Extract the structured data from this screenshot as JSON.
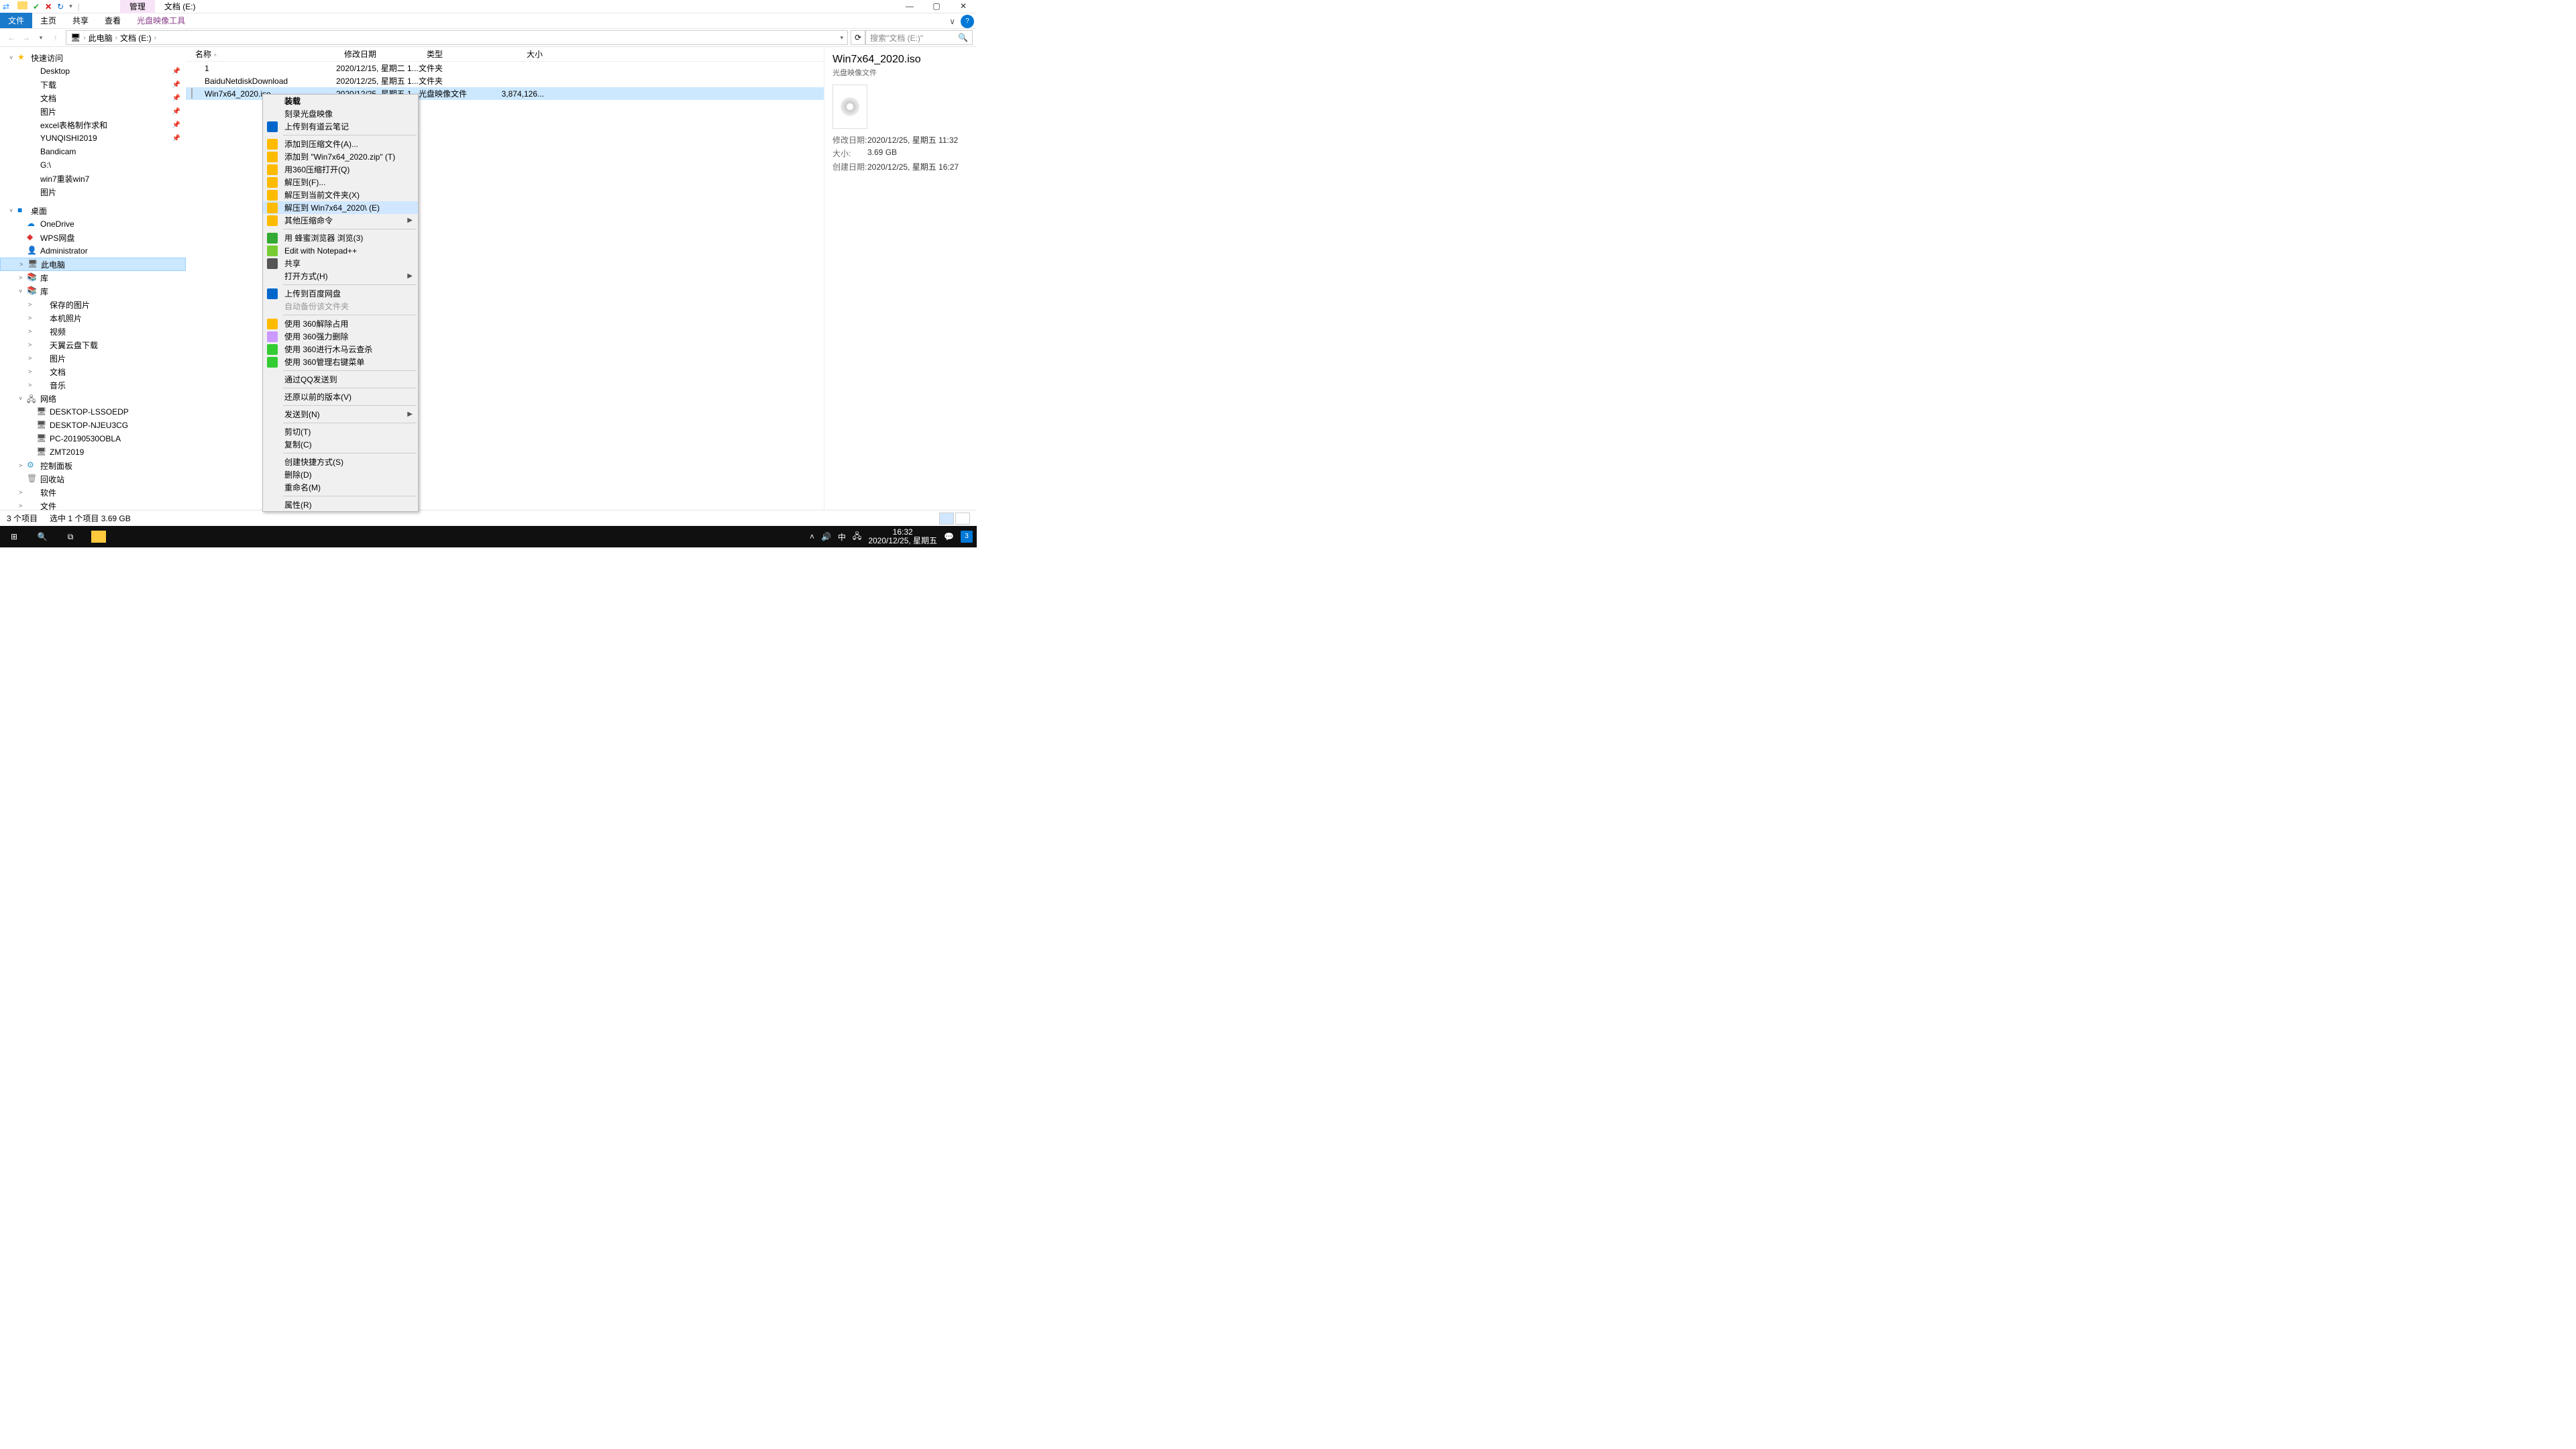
{
  "title_tabs": {
    "manage": "管理",
    "location": "文档 (E:)"
  },
  "ribbon": {
    "file": "文件",
    "home": "主页",
    "share": "共享",
    "view": "查看",
    "disc_tool": "光盘映像工具"
  },
  "breadcrumb": {
    "root": "此电脑",
    "path": "文档 (E:)"
  },
  "search": {
    "placeholder": "搜索\"文档 (E:)\""
  },
  "columns": {
    "name": "名称",
    "date": "修改日期",
    "type": "类型",
    "size": "大小"
  },
  "nav_tree": {
    "quick": "快速访问",
    "quick_items": [
      "Desktop",
      "下载",
      "文档",
      "图片",
      "excel表格制作求和",
      "YUNQISHI2019",
      "Bandicam",
      "G:\\",
      "win7重装win7",
      "图片"
    ],
    "desktop": "桌面",
    "desk_items": [
      "OneDrive",
      "WPS网盘",
      "Administrator",
      "此电脑",
      "库"
    ],
    "lib_items": [
      "保存的图片",
      "本机照片",
      "视频",
      "天翼云盘下载",
      "图片",
      "文档",
      "音乐"
    ],
    "network": "网络",
    "net_items": [
      "DESKTOP-LSSOEDP",
      "DESKTOP-NJEU3CG",
      "PC-20190530OBLA",
      "ZMT2019"
    ],
    "cpanel": "控制面板",
    "recycle": "回收站",
    "software": "软件",
    "docs": "文件"
  },
  "files": [
    {
      "name": "1",
      "date": "2020/12/15, 星期二 1...",
      "type": "文件夹",
      "size": ""
    },
    {
      "name": "BaiduNetdiskDownload",
      "date": "2020/12/25, 星期五 1...",
      "type": "文件夹",
      "size": ""
    },
    {
      "name": "Win7x64_2020.iso",
      "date": "2020/12/25, 星期五 1...",
      "type": "光盘映像文件",
      "size": "3,874,126..."
    }
  ],
  "details": {
    "title": "Win7x64_2020.iso",
    "sub": "光盘映像文件",
    "mod_label": "修改日期:",
    "mod": "2020/12/25, 星期五 11:32",
    "size_label": "大小:",
    "size": "3.69 GB",
    "create_label": "创建日期:",
    "create": "2020/12/25, 星期五 16:27"
  },
  "status": {
    "count": "3 个项目",
    "sel": "选中 1 个项目  3.69 GB"
  },
  "context": [
    {
      "t": "装载",
      "b": true
    },
    {
      "t": "刻录光盘映像"
    },
    {
      "t": "上传到有道云笔记",
      "i": "blue"
    },
    {
      "sep": 1
    },
    {
      "t": "添加到压缩文件(A)...",
      "i": "zip"
    },
    {
      "t": "添加到 \"Win7x64_2020.zip\" (T)",
      "i": "zip"
    },
    {
      "t": "用360压缩打开(Q)",
      "i": "zip"
    },
    {
      "t": "解压到(F)...",
      "i": "zip"
    },
    {
      "t": "解压到当前文件夹(X)",
      "i": "zip"
    },
    {
      "t": "解压到 Win7x64_2020\\ (E)",
      "i": "zip",
      "hover": true
    },
    {
      "t": "其他压缩命令",
      "i": "zip",
      "sub": true
    },
    {
      "sep": 1
    },
    {
      "t": "用 蜂蜜浏览器 浏览(3)",
      "i": "green"
    },
    {
      "t": "Edit with Notepad++",
      "i": "npp"
    },
    {
      "t": "共享",
      "i": "share"
    },
    {
      "t": "打开方式(H)",
      "sub": true
    },
    {
      "sep": 1
    },
    {
      "t": "上传到百度网盘",
      "i": "baidu"
    },
    {
      "t": "自动备份该文件夹",
      "disabled": true
    },
    {
      "sep": 1
    },
    {
      "t": "使用 360解除占用",
      "i": "360"
    },
    {
      "t": "使用 360强力删除",
      "i": "360d"
    },
    {
      "t": "使用 360进行木马云查杀",
      "i": "360y"
    },
    {
      "t": "使用 360管理右键菜单",
      "i": "360y"
    },
    {
      "sep": 1
    },
    {
      "t": "通过QQ发送到"
    },
    {
      "sep": 1
    },
    {
      "t": "还原以前的版本(V)"
    },
    {
      "sep": 1
    },
    {
      "t": "发送到(N)",
      "sub": true
    },
    {
      "sep": 1
    },
    {
      "t": "剪切(T)"
    },
    {
      "t": "复制(C)"
    },
    {
      "sep": 1
    },
    {
      "t": "创建快捷方式(S)"
    },
    {
      "t": "删除(D)"
    },
    {
      "t": "重命名(M)"
    },
    {
      "sep": 1
    },
    {
      "t": "属性(R)"
    }
  ],
  "tray": {
    "ime": "中",
    "time": "16:32",
    "date": "2020/12/25, 星期五",
    "notif": "3"
  }
}
